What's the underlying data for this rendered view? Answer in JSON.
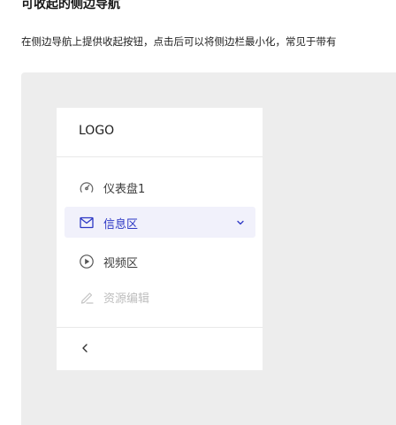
{
  "heading": {
    "title": "可收起的侧边导航",
    "description": "在侧边导航上提供收起按钮，点击后可以将侧边栏最小化，常见于带有"
  },
  "sidebar": {
    "logo": "LOGO",
    "items": [
      {
        "label": "仪表盘1",
        "icon": "dashboard-icon",
        "state": "normal"
      },
      {
        "label": "信息区",
        "icon": "mail-icon",
        "state": "active",
        "expandable": true
      },
      {
        "label": "视频区",
        "icon": "play-circle-icon",
        "state": "normal"
      },
      {
        "label": "资源编辑",
        "icon": "edit-icon",
        "state": "disabled"
      }
    ],
    "collapse_icon": "chevron-left-icon"
  },
  "colors": {
    "accent": "#2c37c4",
    "active_bg": "#f1f1fb",
    "demo_bg": "#ededed",
    "disabled_text": "#bdbdbd"
  }
}
